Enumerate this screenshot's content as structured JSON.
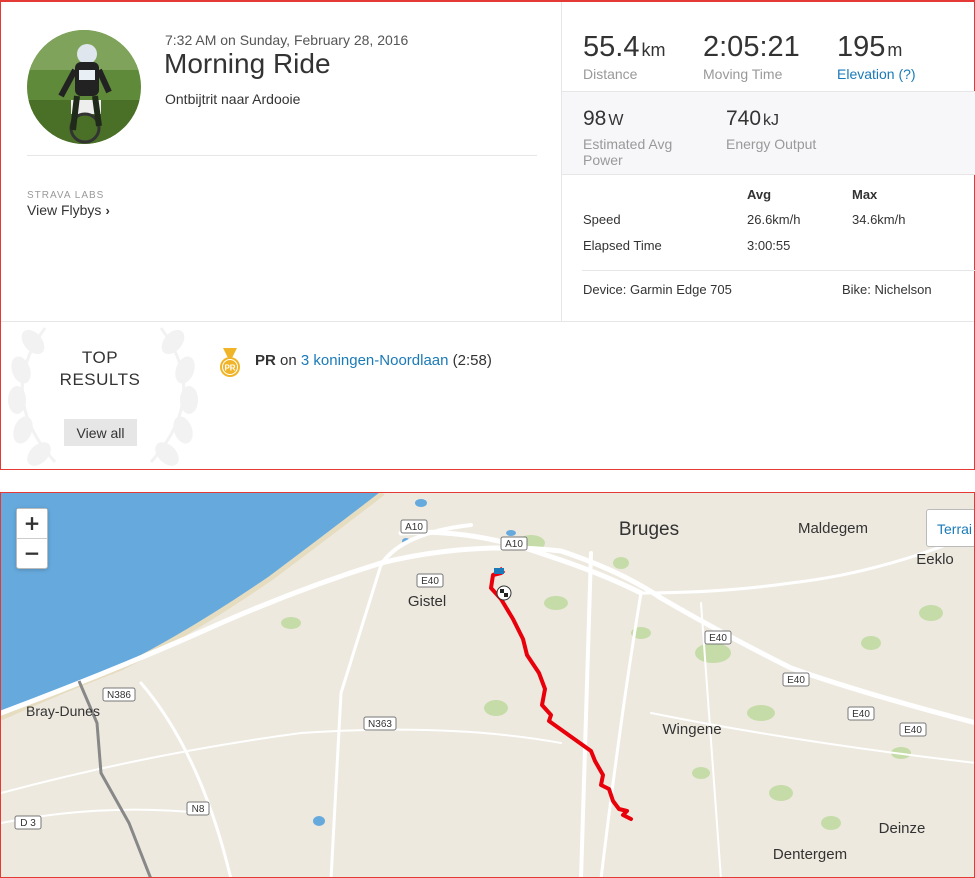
{
  "activity": {
    "datetime": "7:32 AM on Sunday, February 28, 2016",
    "title": "Morning Ride",
    "description": "Ontbijtrit naar Ardooie"
  },
  "labs": {
    "label": "STRAVA LABS",
    "flybys_link": "View Flybys"
  },
  "stats": {
    "distance": {
      "value": "55.4",
      "unit": "km",
      "label": "Distance"
    },
    "moving_time": {
      "value": "2:05:21",
      "label": "Moving Time"
    },
    "elevation": {
      "value": "195",
      "unit": "m",
      "label": "Elevation (?)"
    },
    "power": {
      "value": "98",
      "unit": "W",
      "label": "Estimated Avg Power"
    },
    "energy": {
      "value": "740",
      "unit": "kJ",
      "label": "Energy Output"
    }
  },
  "more_stats": {
    "headers": [
      "Avg",
      "Max"
    ],
    "rows": [
      {
        "label": "Speed",
        "avg": "26.6km/h",
        "max": "34.6km/h"
      },
      {
        "label": "Elapsed Time",
        "avg": "3:00:55",
        "max": ""
      }
    ],
    "device": "Device: Garmin Edge 705",
    "bike": "Bike: Nichelson"
  },
  "top_results": {
    "title_line1": "TOP",
    "title_line2": "RESULTS",
    "view_all": "View all",
    "medal_text": "PR",
    "pr_label": "PR",
    "pr_connector": "on",
    "segment_name": "3 koningen-Noordlaan",
    "segment_time": "(2:58)"
  },
  "map": {
    "zoom_in": "+",
    "zoom_out": "−",
    "terrain_button": "Terrai",
    "towns": {
      "bruges": "Bruges",
      "maldegem": "Maldegem",
      "eeklo": "Eeklo",
      "gistel": "Gistel",
      "bray_dunes": "Bray-Dunes",
      "wingene": "Wingene",
      "deinze": "Deinze",
      "dentergem": "Dentergem"
    },
    "roads": {
      "a10_west": "A10",
      "a10_east": "A10",
      "e40_gistel": "E40",
      "e40_1": "E40",
      "e40_2": "E40",
      "e40_3": "E40",
      "e40_4": "E40",
      "n386": "N386",
      "n363": "N363",
      "n8": "N8",
      "d3": "D 3"
    },
    "colors": {
      "sea": "#66aadd",
      "land": "#ede9df",
      "route": "#e8000b",
      "forest": "#c6dca8"
    }
  }
}
